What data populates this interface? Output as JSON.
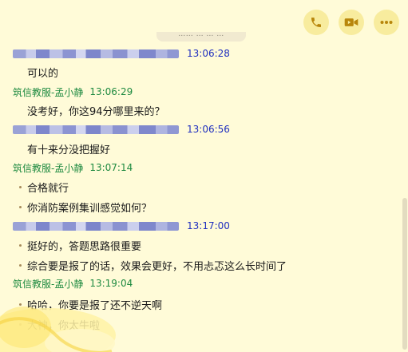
{
  "toolbar": {
    "icons": [
      "phone-icon",
      "video-camera-icon",
      "more-icon"
    ]
  },
  "date_divider": {
    "text": "…… … … …"
  },
  "messages": [
    {
      "sender": "",
      "sender_blurred": true,
      "time": "13:06:28",
      "lines": [
        {
          "text": "可以的",
          "bullet": false
        }
      ]
    },
    {
      "sender": "筑信教服-孟小静",
      "sender_blurred": false,
      "time": "13:06:29",
      "lines": [
        {
          "text": "没考好，你这94分哪里来的？",
          "bullet": false
        }
      ]
    },
    {
      "sender": "",
      "sender_blurred": true,
      "time": "13:06:56",
      "lines": [
        {
          "text": "有十来分没把握好",
          "bullet": false
        }
      ]
    },
    {
      "sender": "筑信教服-孟小静",
      "sender_blurred": false,
      "time": "13:07:14",
      "lines": [
        {
          "text": "合格就行",
          "bullet": true
        },
        {
          "text": "你消防案例集训感觉如何？",
          "bullet": true
        }
      ]
    },
    {
      "sender": "",
      "sender_blurred": true,
      "time": "13:17:00",
      "lines": [
        {
          "text": "挺好的，答题思路很重要",
          "bullet": true
        },
        {
          "text": "综合要是报了的话，效果会更好，不用忐忑这么长时间了",
          "bullet": true
        }
      ]
    },
    {
      "sender": "筑信教服-孟小静",
      "sender_blurred": false,
      "time": "13:19:04",
      "lines": [
        {
          "text": "哈哈，你要是报了还不逆天啊",
          "bullet": true
        },
        {
          "text": "大神，你太牛啦",
          "bullet": true
        }
      ]
    }
  ],
  "colors": {
    "background": "#fffbd8",
    "agent_name": "#1e8a40",
    "self_time": "#1f2fbf",
    "button_bg": "#f8ec9e",
    "icon": "#b8860b"
  }
}
